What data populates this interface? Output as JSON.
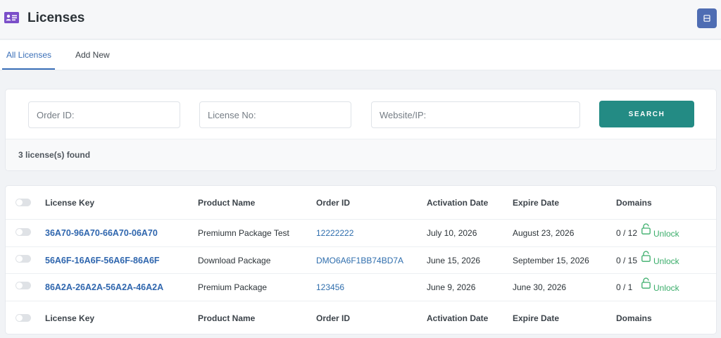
{
  "header": {
    "title": "Licenses",
    "icon": "id-card-icon",
    "action_icon": "screen-options-icon",
    "accent": "#7b4fc9"
  },
  "tabs": [
    {
      "label": "All Licenses",
      "active": true
    },
    {
      "label": "Add New",
      "active": false
    }
  ],
  "search": {
    "order_placeholder": "Order ID:",
    "license_placeholder": "License No:",
    "website_placeholder": "Website/IP:",
    "button_label": "SEARCH",
    "button_color": "#238b84",
    "found_text": "3 license(s) found"
  },
  "table": {
    "columns": [
      "License Key",
      "Product Name",
      "Order ID",
      "Activation Date",
      "Expire Date",
      "Domains"
    ],
    "rows": [
      {
        "key": "36A70-96A70-66A70-06A70",
        "product": "Premiumn Package Test",
        "order_id": "12222222",
        "activation": "July 10, 2026",
        "expire": "August 23, 2026",
        "domains": "0 / 12",
        "action": "Unlock"
      },
      {
        "key": "56A6F-16A6F-56A6F-86A6F",
        "product": "Download Package",
        "order_id": "DMO6A6F1BB74BD7A",
        "activation": "June 15, 2026",
        "expire": "September 15, 2026",
        "domains": "0 / 15",
        "action": "Unlock"
      },
      {
        "key": "86A2A-26A2A-56A2A-46A2A",
        "product": "Premium Package",
        "order_id": "123456",
        "activation": "June 9, 2026",
        "expire": "June 30, 2026",
        "domains": "0 / 1",
        "action": "Unlock"
      }
    ],
    "link_color": "#2f66ae",
    "unlock_color": "#3aad6a",
    "unlock_icon": "unlock-icon"
  }
}
